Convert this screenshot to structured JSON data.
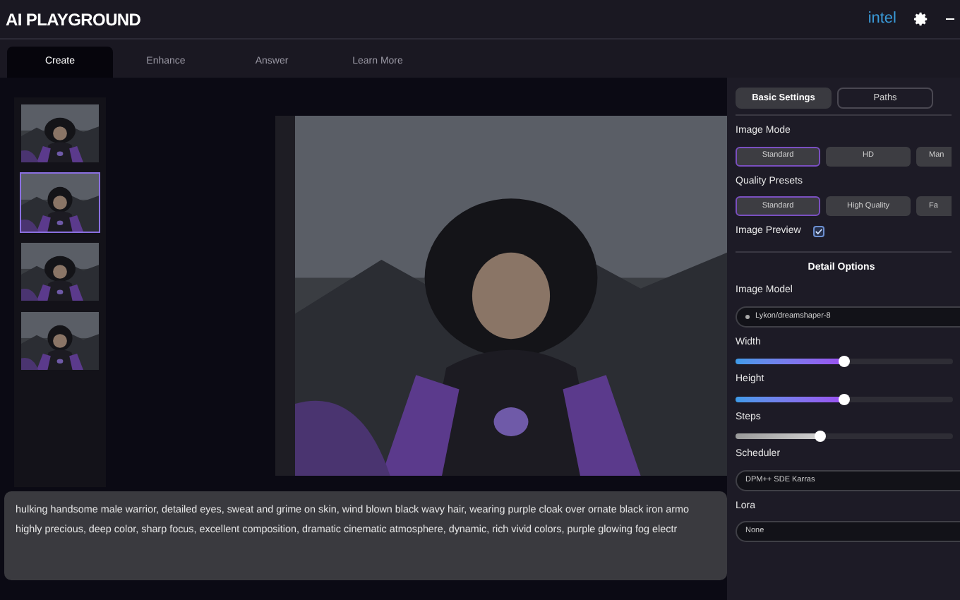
{
  "app_title": "AI PLAYGROUND",
  "brand": "intel",
  "tabs": [
    {
      "label": "Create",
      "selected": true
    },
    {
      "label": "Enhance",
      "selected": false
    },
    {
      "label": "Answer",
      "selected": false
    },
    {
      "label": "Learn More",
      "selected": false
    }
  ],
  "thumbnails": [
    {
      "kind": "picture",
      "selected": false
    },
    {
      "kind": "picture",
      "selected": true
    },
    {
      "kind": "picture",
      "selected": false
    },
    {
      "kind": "picture",
      "selected": false
    }
  ],
  "preview": {
    "kind": "picture"
  },
  "prompt": {
    "lines": [
      "hulking handsome male warrior, detailed eyes, sweat and grime on skin, wind blown black wavy hair, wearing purple cloak over ornate black iron armo",
      "highly precious, deep color, sharp focus, excellent composition, dramatic cinematic atmosphere, dynamic, rich vivid colors, purple glowing fog electr"
    ]
  },
  "settings": {
    "tabs": [
      {
        "label": "Basic Settings",
        "selected": true
      },
      {
        "label": "Paths",
        "selected": false
      }
    ],
    "image_mode": {
      "label": "Image Mode",
      "options": [
        {
          "label": "Standard",
          "selected": true
        },
        {
          "label": "HD",
          "selected": false
        },
        {
          "label": "Man",
          "selected": false
        }
      ]
    },
    "quality_presets": {
      "label": "Quality Presets",
      "options": [
        {
          "label": "Standard",
          "selected": true
        },
        {
          "label": "High Quality",
          "selected": false
        },
        {
          "label": "Fa",
          "selected": false
        }
      ]
    },
    "image_preview": {
      "label": "Image Preview",
      "checked": true
    },
    "detail_title": "Detail Options",
    "image_model": {
      "label": "Image Model",
      "value": "Lykon/dreamshaper-8"
    },
    "sliders": [
      {
        "label": "Width",
        "level": 0.5,
        "kind": "gradient"
      },
      {
        "label": "Height",
        "level": 0.5,
        "kind": "gradient"
      },
      {
        "label": "Steps",
        "level": 0.39,
        "kind": "gray"
      }
    ],
    "scheduler": {
      "label": "Scheduler",
      "value": "DPM++ SDE Karras"
    },
    "lora": {
      "label": "Lora",
      "value": "None"
    }
  }
}
